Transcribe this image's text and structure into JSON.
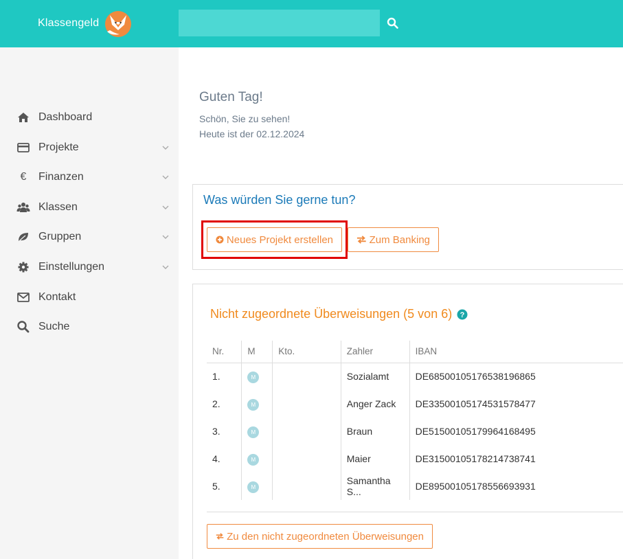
{
  "header": {
    "brand": "Klassengeld",
    "search_placeholder": "",
    "search_icon": "search-icon"
  },
  "sidebar": {
    "items": [
      {
        "label": "Dashboard",
        "icon": "home-icon",
        "has_chevron": false
      },
      {
        "label": "Projekte",
        "icon": "credit-card-icon",
        "has_chevron": true
      },
      {
        "label": "Finanzen",
        "icon": "euro-icon",
        "has_chevron": true
      },
      {
        "label": "Klassen",
        "icon": "users-icon",
        "has_chevron": true
      },
      {
        "label": "Gruppen",
        "icon": "leaf-icon",
        "has_chevron": true
      },
      {
        "label": "Einstellungen",
        "icon": "gear-icon",
        "has_chevron": true
      },
      {
        "label": "Kontakt",
        "icon": "envelope-icon",
        "has_chevron": false
      },
      {
        "label": "Suche",
        "icon": "search-icon",
        "has_chevron": false
      }
    ]
  },
  "greeting": {
    "title": "Guten Tag!",
    "subtitle": "Schön, Sie zu sehen!",
    "date_line": "Heute ist der 02.12.2024"
  },
  "actions": {
    "title": "Was würden Sie gerne tun?",
    "new_project_label": "Neues Projekt erstellen",
    "banking_label": "Zum Banking"
  },
  "unassigned": {
    "title": "Nicht zugeordnete Überweisungen (5 von 6)",
    "columns": [
      "Nr.",
      "M",
      "Kto.",
      "Zahler",
      "IBAN"
    ],
    "rows": [
      {
        "nr": "1.",
        "m": "M",
        "kto": "",
        "zahler": "Sozialamt",
        "iban": "DE68500105176538196865"
      },
      {
        "nr": "2.",
        "m": "M",
        "kto": "",
        "zahler": "Anger Zack",
        "iban": "DE33500105174531578477"
      },
      {
        "nr": "3.",
        "m": "M",
        "kto": "",
        "zahler": "Braun",
        "iban": "DE51500105179964168495"
      },
      {
        "nr": "4.",
        "m": "M",
        "kto": "",
        "zahler": "Maier",
        "iban": "DE31500105178214738741"
      },
      {
        "nr": "5.",
        "m": "M",
        "kto": "",
        "zahler": "Samantha S...",
        "iban": "DE89500105178556693931"
      }
    ],
    "button_label": "Zu den nicht zugeordneten Überweisungen"
  },
  "colors": {
    "header_bg": "#1fc8c2",
    "accent_orange": "#f08a3e",
    "title_blue": "#1b7ab8",
    "highlight_red": "#e00000"
  }
}
